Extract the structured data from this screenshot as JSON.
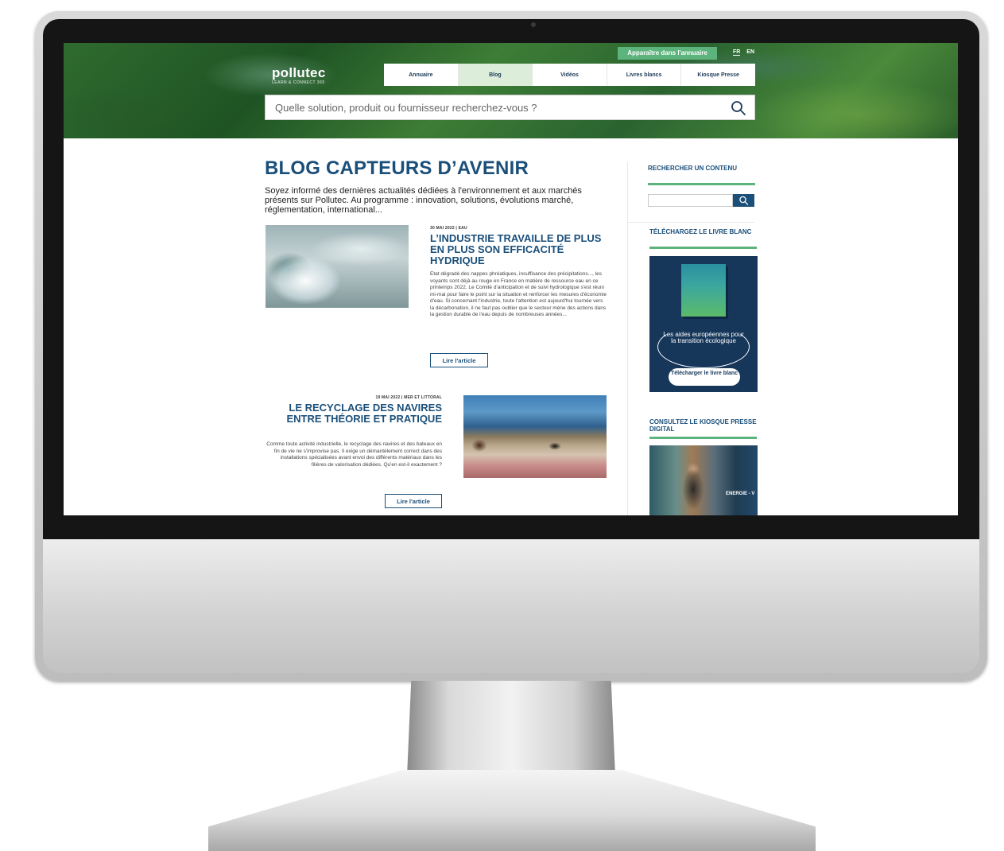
{
  "header": {
    "logo": "pollutec",
    "logo_tagline": "LEARN & CONNECT 365",
    "cta": "Apparaître dans l'annuaire",
    "languages": [
      "FR",
      "EN"
    ],
    "nav": [
      "Annuaire",
      "Blog",
      "Vidéos",
      "Livres blancs",
      "Kiosque Presse"
    ],
    "nav_active": "Blog",
    "search_placeholder": "Quelle solution, produit ou fournisseur recherchez-vous ?"
  },
  "main": {
    "title": "BLOG CAPTEURS D’AVENIR",
    "intro": "Soyez informé des dernières actualités dédiées à l'environnement et aux marchés présents sur Pollutec. Au programme : innovation, solutions, évolutions marché, réglementation, international...",
    "articles": [
      {
        "meta": "30 MAI 2022 | EAU",
        "title": "L’INDUSTRIE TRAVAILLE DE PLUS EN PLUS SON EFFICACITÉ HYDRIQUE",
        "excerpt": "Etat dégradé des nappes phréatiques, insuffisance des précipitations..., les voyants sont déjà au rouge en France en matière de ressource eau en ce printemps 2022. Le Comité d'anticipation et de suivi hydrologique s'est réuni mi-mai pour faire le point sur la situation et renforcer les mesures d'économie d'eau. Si concernant l'industrie, toute l'attention est aujourd'hui tournée vers la décarbonation, il ne faut pas oublier que le secteur mène des actions dans la gestion durable de l'eau depuis de nombreuses années...",
        "button": "Lire l'article"
      },
      {
        "meta": "19 MAI 2022 | MER ET LITTORAL",
        "title": "LE RECYCLAGE DES NAVIRES ENTRE THÉORIE ET PRATIQUE",
        "excerpt": "Comme toute activité industrielle, le recyclage des navires et des bateaux en fin de vie ne s'improvise pas. Il exige un démantèlement correct dans des installations spécialisées avant envoi des différents matériaux dans les filières de valorisation dédiées. Qu'en est-il exactement ?",
        "button": "Lire l'article"
      }
    ]
  },
  "sidebar": {
    "search_title": "RECHERCHER UN CONTENU",
    "whitepaper_title": "TÉLÉCHARGEZ LE LIVRE BLANC",
    "whitepaper_text": "Les aides européennes pour la transition écologique",
    "whitepaper_button": "Télécharger le livre blanc",
    "kiosk_title": "CONSULTEZ LE KIOSQUE PRESSE DIGITAL",
    "kiosk_tag": "ENERGIE - V"
  },
  "colors": {
    "brand_blue": "#1a4f7a",
    "brand_green": "#5db37c",
    "nav_active_bg": "#dcedd9",
    "whitepaper_bg": "#16365a"
  }
}
